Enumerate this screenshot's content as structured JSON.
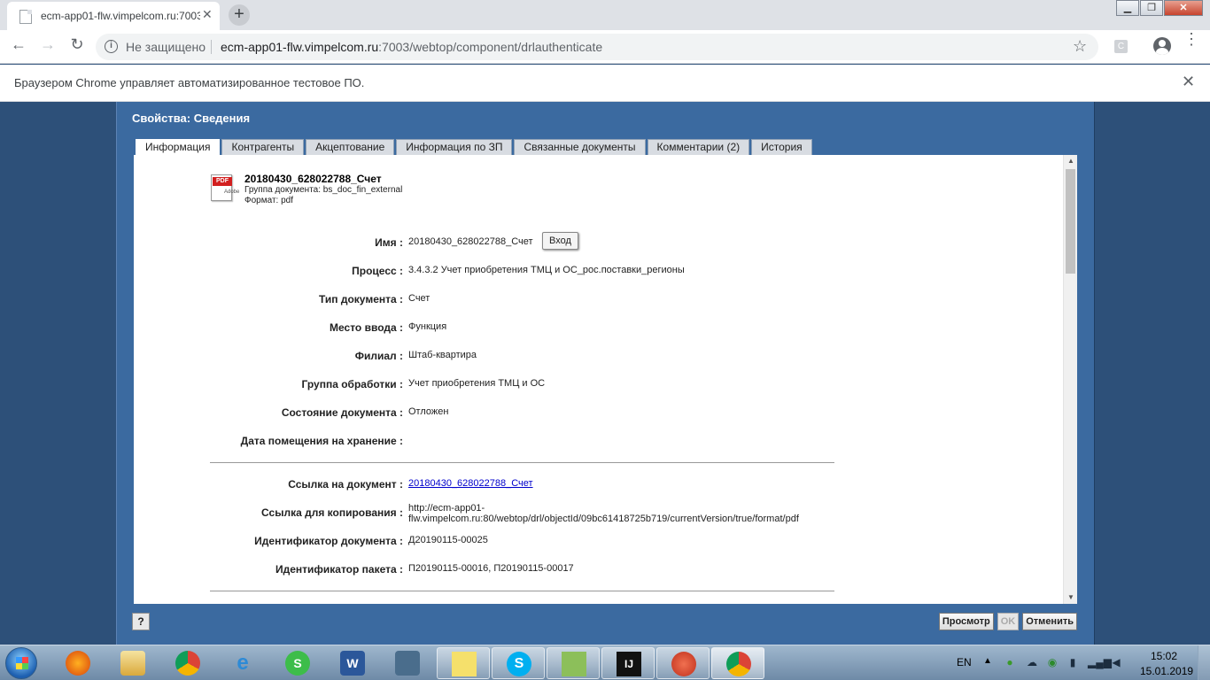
{
  "browser": {
    "tab_title": "ecm-app01-flw.vimpelcom.ru:7003/webtop/component/drlauthenticate",
    "tab_close": "✕",
    "new_tab": "+",
    "security_label": "Не защищено",
    "url_host": "ecm-app01-flw.vimpelcom.ru",
    "url_path": ":7003/webtop/component/drlauthenticate",
    "infobar_text": "Браузером Chrome управляет автоматизированное тестовое ПО.",
    "infobar_close": "✕"
  },
  "dialog": {
    "title": "Свойства: Сведения",
    "tabs": [
      {
        "label": "Информация",
        "active": true
      },
      {
        "label": "Контрагенты",
        "active": false
      },
      {
        "label": "Акцептование",
        "active": false
      },
      {
        "label": "Информация по ЗП",
        "active": false
      },
      {
        "label": "Связанные документы",
        "active": false
      },
      {
        "label": "Комментарии (2)",
        "active": false
      },
      {
        "label": "История",
        "active": false
      }
    ],
    "doc": {
      "icon_label": "PDF",
      "icon_sub": "Adobe",
      "name": "20180430_628022788_Счет",
      "group_line": "Группа документа:  bs_doc_fin_external",
      "format_line": "Формат:  pdf"
    },
    "fields": [
      {
        "label": "Имя :",
        "value": "20180430_628022788_Счет"
      },
      {
        "label": "Процесс :",
        "value": "3.4.3.2 Учет приобретения ТМЦ и ОС_рос.поставки_регионы"
      },
      {
        "label": "Тип документа :",
        "value": "Счет"
      },
      {
        "label": "Место ввода :",
        "value": "Функция"
      },
      {
        "label": "Филиал :",
        "value": "Штаб-квартира"
      },
      {
        "label": "Группа обработки :",
        "value": "Учет приобретения ТМЦ и ОС"
      },
      {
        "label": "Состояние документа :",
        "value": "Отложен"
      },
      {
        "label": "Дата помещения на хранение :",
        "value": ""
      }
    ],
    "links": [
      {
        "label": "Ссылка на документ :",
        "value": "20180430_628022788_Счет",
        "is_link": true
      },
      {
        "label": "Ссылка для копирования :",
        "value_line1": "http://ecm-app01-",
        "value_line2": "flw.vimpelcom.ru:80/webtop/drl/objectId/09bc61418725b719/currentVersion/true/format/pdf"
      },
      {
        "label": "Идентификатор документа :",
        "value": "Д20190115-00025"
      },
      {
        "label": "Идентификатор пакета :",
        "value": "П20190115-00016, П20190115-00017"
      }
    ],
    "tooltip_button": "Вход",
    "help": "?",
    "buttons": {
      "view": "Просмотр",
      "ok": "OK",
      "cancel": "Отменить"
    }
  },
  "taskbar": {
    "lang": "EN",
    "time": "15:02",
    "date": "15.01.2019"
  }
}
